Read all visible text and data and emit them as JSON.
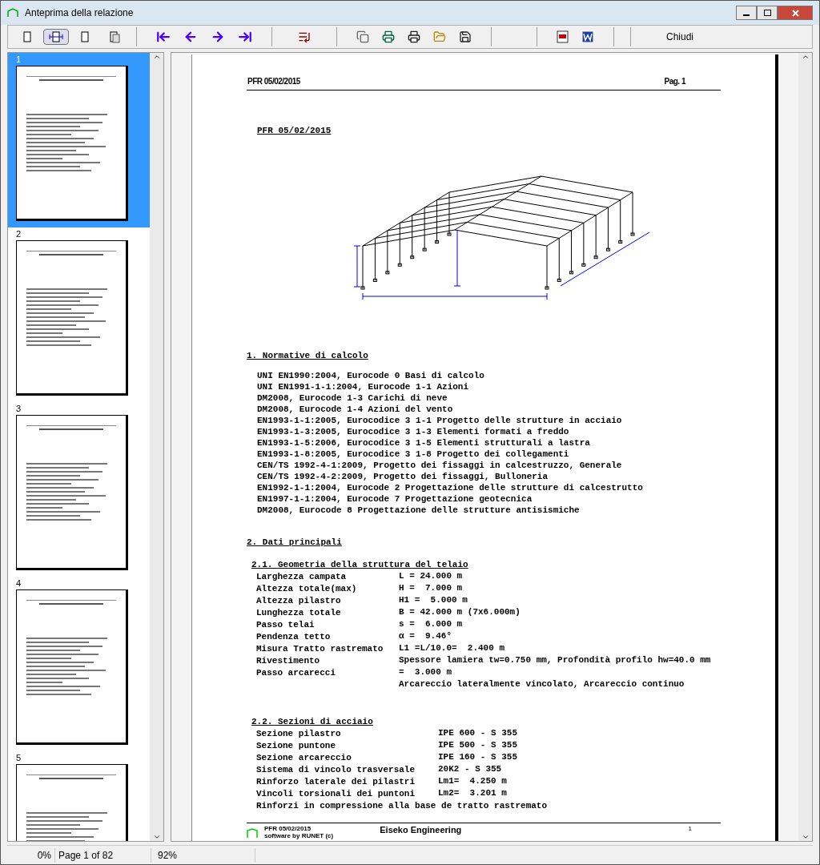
{
  "window": {
    "title": "Anteprima della relazione"
  },
  "toolbar": {
    "view_buttons": [
      {
        "selected": false
      },
      {
        "selected": true
      },
      {
        "selected": false
      },
      {
        "selected": false
      }
    ],
    "close_button": "Chiudi"
  },
  "thumbnails": [
    {
      "number": "1",
      "selected": true
    },
    {
      "number": "2",
      "selected": false
    },
    {
      "number": "3",
      "selected": false
    },
    {
      "number": "4",
      "selected": false
    },
    {
      "number": "5",
      "selected": false
    }
  ],
  "page": {
    "header_left": "PFR 05/02/2015",
    "header_right": "Pag. 1",
    "title": "PFR 05/02/2015",
    "sections": [
      {
        "heading": "1. Normative di calcolo",
        "subsections": [
          {
            "rows": [
              {
                "label": "UNI EN1990:2004, Eurocode 0 Basi di calcolo"
              },
              {
                "label": "UNI EN1991-1-1:2004, Eurocode 1-1 Azioni"
              },
              {
                "label": "DM2008, Eurocode 1-3 Carichi di neve"
              },
              {
                "label": "DM2008, Eurocode 1-4 Azioni del vento"
              },
              {
                "label": "EN1993-1-1:2005, Eurocodice 3 1-1 Progetto delle strutture in acciaio"
              },
              {
                "label": "EN1993-1-3:2005, Eurocodice 3 1-3 Elementi formati a freddo"
              },
              {
                "label": "EN1993-1-5:2006, Eurocodice 3 1-5 Elementi strutturali a lastra"
              },
              {
                "label": "EN1993-1-8:2005, Eurocodice 3 1-8 Progetto dei collegamenti"
              },
              {
                "label": "CEN/TS 1992-4-1:2009, Progetto dei fissaggi in calcestruzzo, Generale"
              },
              {
                "label": "CEN/TS 1992-4-2:2009, Progetto dei fissaggi, Bulloneria"
              },
              {
                "label": "EN1992-1-1:2004, Eurocode 2 Progettazione delle strutture di calcestrutto"
              },
              {
                "label": "EN1997-1-1:2004, Eurocode 7 Progettazione geotecnica"
              },
              {
                "label": "DM2008, Eurocode 8 Progettazione delle strutture antisismiche"
              }
            ]
          }
        ]
      },
      {
        "heading": "2. Dati principali",
        "subsections": [
          {
            "heading": "2.1. Geometria della struttura del telaio",
            "rows": [
              {
                "label": "Larghezza campata",
                "value": "L = 24.000 m"
              },
              {
                "label": "Altezza totale(max)",
                "value": "H =  7.000 m"
              },
              {
                "label": "Altezza pilastro",
                "value": "H1 =  5.000 m"
              },
              {
                "label": "Lunghezza totale",
                "value": "B = 42.000 m (7x6.000m)"
              },
              {
                "label": "Passo telai",
                "value": "s =  6.000 m"
              },
              {
                "label": "Pendenza tetto",
                "value": "α =  9.46°"
              },
              {
                "label": "Misura Tratto rastremato",
                "value": "L1 =L/10.0=  2.400 m"
              },
              {
                "label": "Rivestimento",
                "value": "Spessore lamiera tw=0.750 mm, Profondità profilo hw=40.0 mm"
              },
              {
                "label": "Passo arcarecci",
                "value": "=  3.000 m"
              },
              {
                "value": "Arcareccio lateralmente vincolato, Arcareccio continuo"
              }
            ]
          },
          {
            "heading": "2.2. Sezioni di acciaio",
            "rows": [
              {
                "label": "Sezione pilastro",
                "value": "IPE 600 - S 355"
              },
              {
                "label": "Sezione puntone",
                "value": "IPE 500 - S 355"
              },
              {
                "label": "Sezione arcareccio",
                "value": "IPE 160 - S 355"
              },
              {
                "label": "Sistema di vincolo trasversale",
                "value": "20K2 - S 355"
              },
              {
                "label": "Rinforzo laterale dei pilastri",
                "value": "Lm1=  4.250 m"
              },
              {
                "label": "Vincoli torsionali dei puntoni",
                "value": "Lm2=  3.201 m"
              },
              {
                "label": "Rinforzi in compressione alla base de tratto rastremato"
              }
            ]
          }
        ]
      }
    ],
    "footer": {
      "date": "PFR 05/02/2015",
      "credit": "software by RUNET (c)",
      "company": "Eiseko Engineering",
      "page_number": "1"
    }
  },
  "status_bar": {
    "progress": "0%",
    "page": "Page 1 of 82",
    "zoom": "92%"
  }
}
